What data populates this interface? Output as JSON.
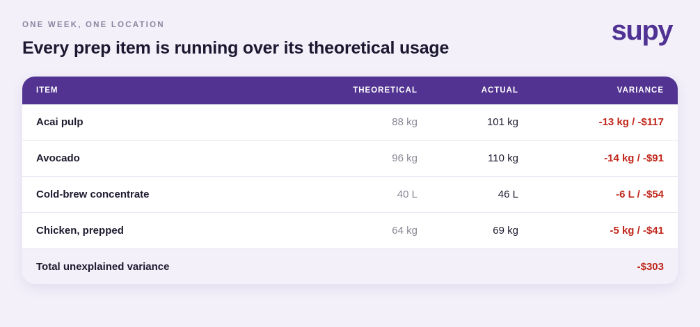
{
  "header": {
    "eyebrow": "ONE WEEK, ONE LOCATION",
    "title": "Every prep item is running over its theoretical usage",
    "logo": "supy"
  },
  "table": {
    "columns": [
      "ITEM",
      "THEORETICAL",
      "ACTUAL",
      "VARIANCE"
    ],
    "rows": [
      {
        "item": "Acai pulp",
        "theoretical": "88 kg",
        "actual": "101 kg",
        "variance": "-13 kg / -$117"
      },
      {
        "item": "Avocado",
        "theoretical": "96 kg",
        "actual": "110 kg",
        "variance": "-14 kg / -$91"
      },
      {
        "item": "Cold-brew concentrate",
        "theoretical": "40 L",
        "actual": "46 L",
        "variance": "-6 L / -$54"
      },
      {
        "item": "Chicken, prepped",
        "theoretical": "64 kg",
        "actual": "69 kg",
        "variance": "-5 kg / -$41"
      }
    ],
    "total": {
      "label": "Total unexplained variance",
      "value": "-$303"
    }
  },
  "colors": {
    "brand": "#523391",
    "negative": "#c0271b",
    "background": "#f3f0fa"
  }
}
